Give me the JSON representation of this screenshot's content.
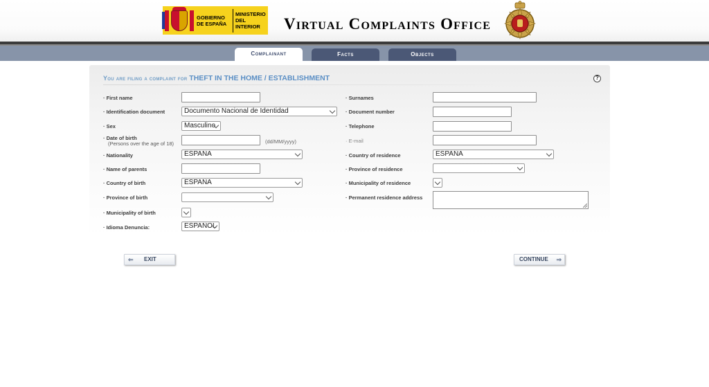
{
  "header": {
    "gov_line1": "GOBIERNO",
    "gov_line2": "DE ESPAÑA",
    "ministry_line1": "MINISTERIO",
    "ministry_line2": "DEL INTERIOR",
    "title": "Virtual Complaints Office"
  },
  "tabs": [
    {
      "label": "Complainant",
      "active": true
    },
    {
      "label": "Facts",
      "active": false
    },
    {
      "label": "Objects",
      "active": false
    }
  ],
  "form": {
    "heading_lead": "You are filing a complaint for",
    "heading_crime": "THEFT IN THE HOME / ESTABLISHMENT",
    "left": {
      "first_name": {
        "label": "· First name",
        "value": ""
      },
      "identification_document": {
        "label": "· Identification document",
        "value": "Documento Nacional de Identidad"
      },
      "sex": {
        "label": "· Sex",
        "value": "Masculino"
      },
      "date_of_birth": {
        "label": "· Date of birth",
        "sublabel": "(Persons over the age of 18)",
        "value": "",
        "hint": "(dd/MM/yyyy)"
      },
      "nationality": {
        "label": "· Nationality",
        "value": "ESPAÑA"
      },
      "name_of_parents": {
        "label": "· Name of parents",
        "value": ""
      },
      "country_of_birth": {
        "label": "· Country of birth",
        "value": "ESPAÑA"
      },
      "province_of_birth": {
        "label": "· Province of birth",
        "value": ""
      },
      "municipality_of_birth": {
        "label": "· Municipality of birth",
        "value": ""
      },
      "idioma_denuncia": {
        "label": "· Idioma Denuncia:",
        "value": "ESPAÑOL"
      }
    },
    "right": {
      "surnames": {
        "label": "· Surnames",
        "value": ""
      },
      "document_number": {
        "label": "· Document number",
        "value": ""
      },
      "telephone": {
        "label": "· Telephone",
        "value": ""
      },
      "email": {
        "label": "· E-mail",
        "value": ""
      },
      "country_of_residence": {
        "label": "· Country of residence",
        "value": "ESPAÑA"
      },
      "province_of_residence": {
        "label": "· Province of residence",
        "value": ""
      },
      "municipality_of_residence": {
        "label": "· Municipality of residence",
        "value": ""
      },
      "permanent_residence_address": {
        "label": "· Permanent residence address",
        "value": ""
      }
    }
  },
  "buttons": {
    "exit": "EXIT",
    "continue": "CONTINUE"
  },
  "colors": {
    "tabbar": "#8794a9",
    "tab_inactive": "#4b5876",
    "heading_blue": "#5b8fc5",
    "gov_yellow": "#f6d21d"
  }
}
